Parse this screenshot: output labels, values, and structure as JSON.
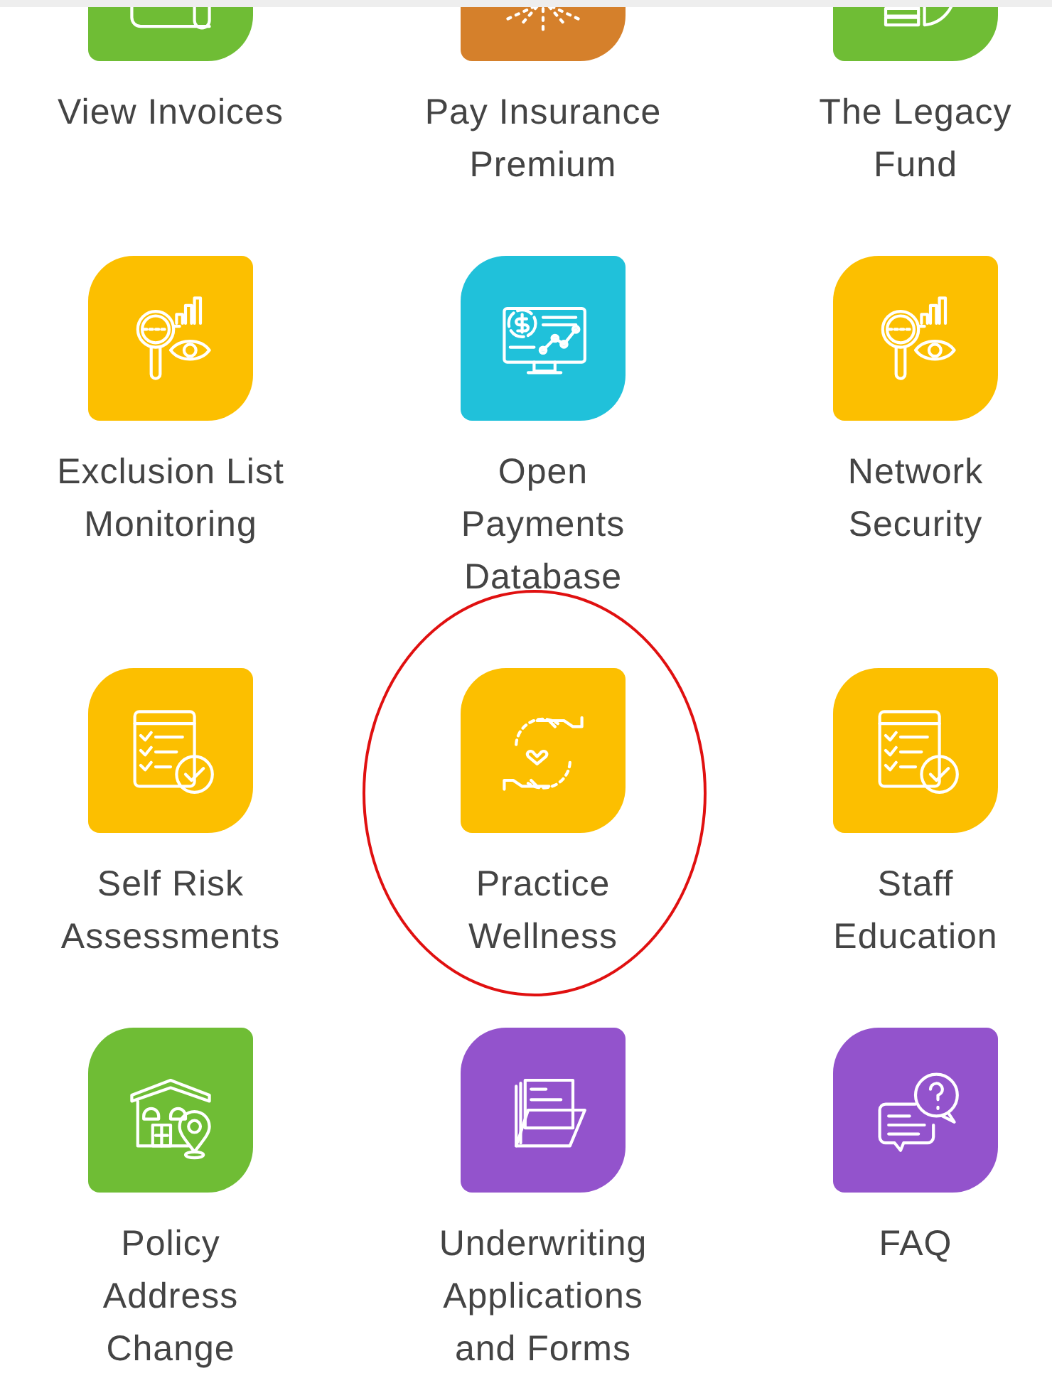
{
  "tiles": [
    {
      "label": [
        "View Invoices"
      ],
      "color": "#6fbd35",
      "kind": "scroll",
      "highlighted": false
    },
    {
      "label": [
        "Pay Insurance",
        "Premium"
      ],
      "color": "#d5802b",
      "kind": "burst",
      "highlighted": false
    },
    {
      "label": [
        "The Legacy",
        "Fund"
      ],
      "color": "#6fbd35",
      "kind": "books",
      "highlighted": false
    },
    {
      "label": [
        "Exclusion List",
        "Monitoring"
      ],
      "color": "#fcbf00",
      "kind": "search-eye",
      "highlighted": false
    },
    {
      "label": [
        "Open",
        "Payments",
        "Database"
      ],
      "color": "#20c1da",
      "kind": "monitor",
      "highlighted": false
    },
    {
      "label": [
        "Network",
        "Security"
      ],
      "color": "#fcbf00",
      "kind": "search-eye",
      "highlighted": false
    },
    {
      "label": [
        "Self Risk",
        "Assessments"
      ],
      "color": "#fcbf00",
      "kind": "checklist",
      "highlighted": false
    },
    {
      "label": [
        "Practice",
        "Wellness"
      ],
      "color": "#fcbf00",
      "kind": "hands",
      "highlighted": true
    },
    {
      "label": [
        "Staff",
        "Education"
      ],
      "color": "#fcbf00",
      "kind": "checklist",
      "highlighted": false
    },
    {
      "label": [
        "Policy",
        "Address",
        "Change"
      ],
      "color": "#6fbd35",
      "kind": "house",
      "highlighted": false
    },
    {
      "label": [
        "Underwriting",
        "Applications",
        "and Forms"
      ],
      "color": "#9353cc",
      "kind": "folder",
      "highlighted": false
    },
    {
      "label": [
        "FAQ"
      ],
      "color": "#9353cc",
      "kind": "chat",
      "highlighted": false
    }
  ]
}
